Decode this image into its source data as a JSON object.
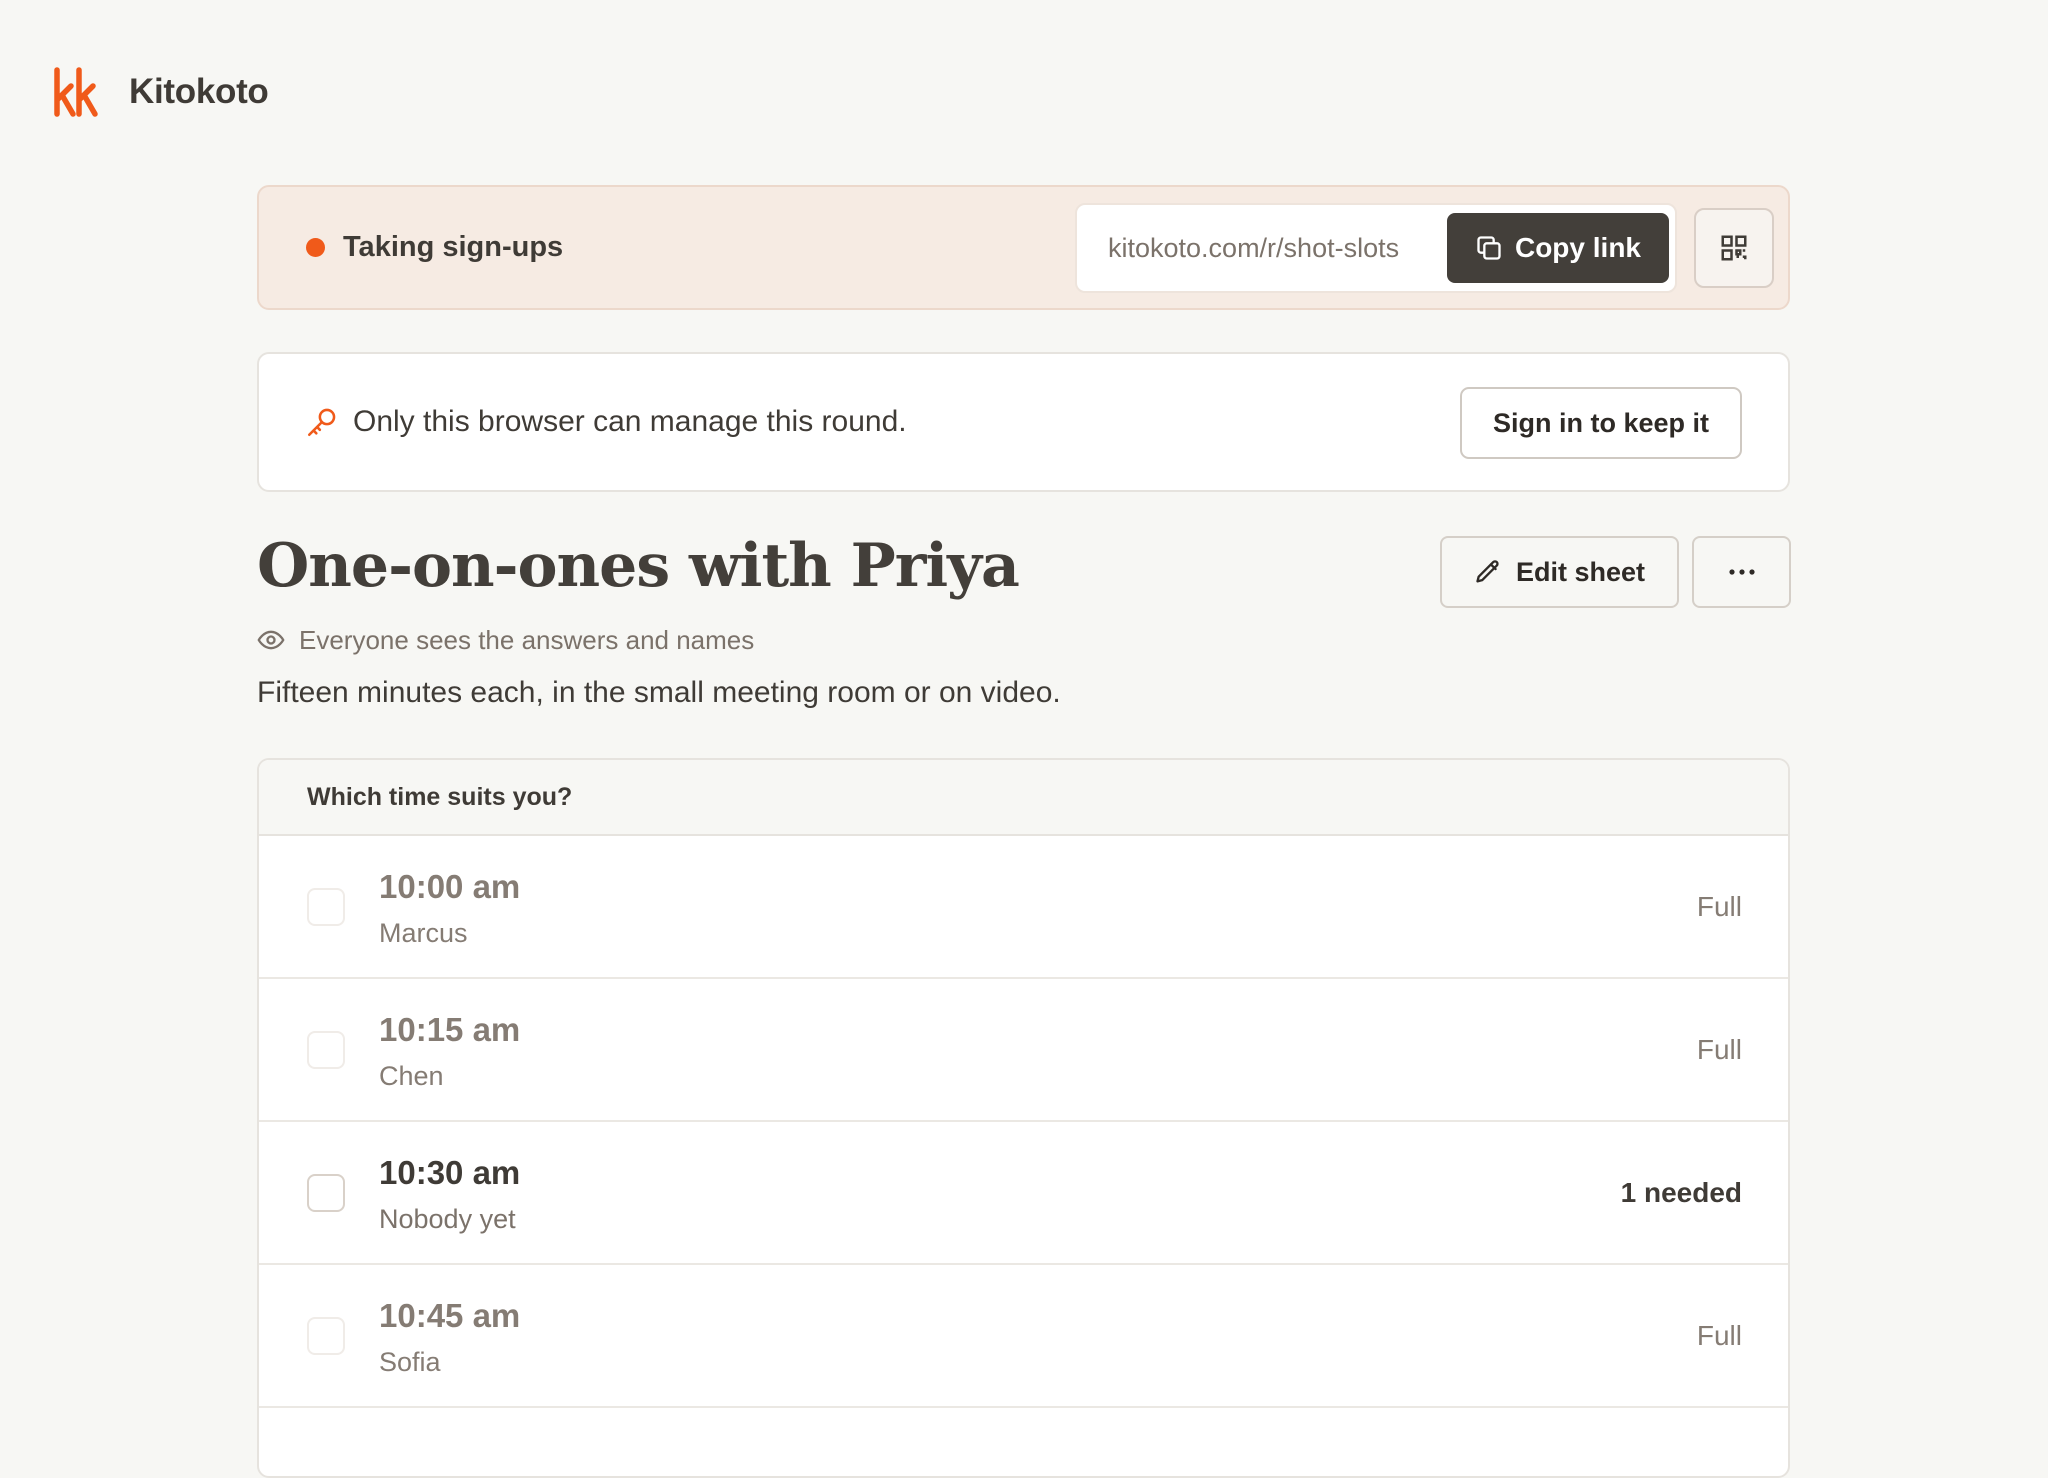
{
  "brand": {
    "name": "Kitokoto",
    "logo_icon": "kk-logo-icon",
    "accent": "#f05a1a"
  },
  "status": {
    "label": "Taking sign-ups",
    "dot_color": "#f05a1a",
    "link_url": "kitokoto.com/r/shot-slots",
    "copy_label": "Copy link",
    "copy_icon": "copy-icon",
    "qr_icon": "qr-code-icon"
  },
  "notice": {
    "icon": "key-icon",
    "text": "Only this browser can manage this round.",
    "button_label": "Sign in to keep it"
  },
  "sheet": {
    "title": "One-on-ones with Priya",
    "edit_label": "Edit sheet",
    "more_icon": "more-horizontal-icon",
    "visibility_icon": "eye-icon",
    "visibility_text": "Everyone sees the answers and names",
    "description": "Fifteen minutes each, in the small meeting room or on video."
  },
  "slots": {
    "question": "Which time suits you?",
    "items": [
      {
        "time": "10:00 am",
        "person": "Marcus",
        "status": "Full",
        "open": false
      },
      {
        "time": "10:15 am",
        "person": "Chen",
        "status": "Full",
        "open": false
      },
      {
        "time": "10:30 am",
        "person": "Nobody yet",
        "status": "1 needed",
        "open": true
      },
      {
        "time": "10:45 am",
        "person": "Sofia",
        "status": "Full",
        "open": false
      }
    ]
  }
}
